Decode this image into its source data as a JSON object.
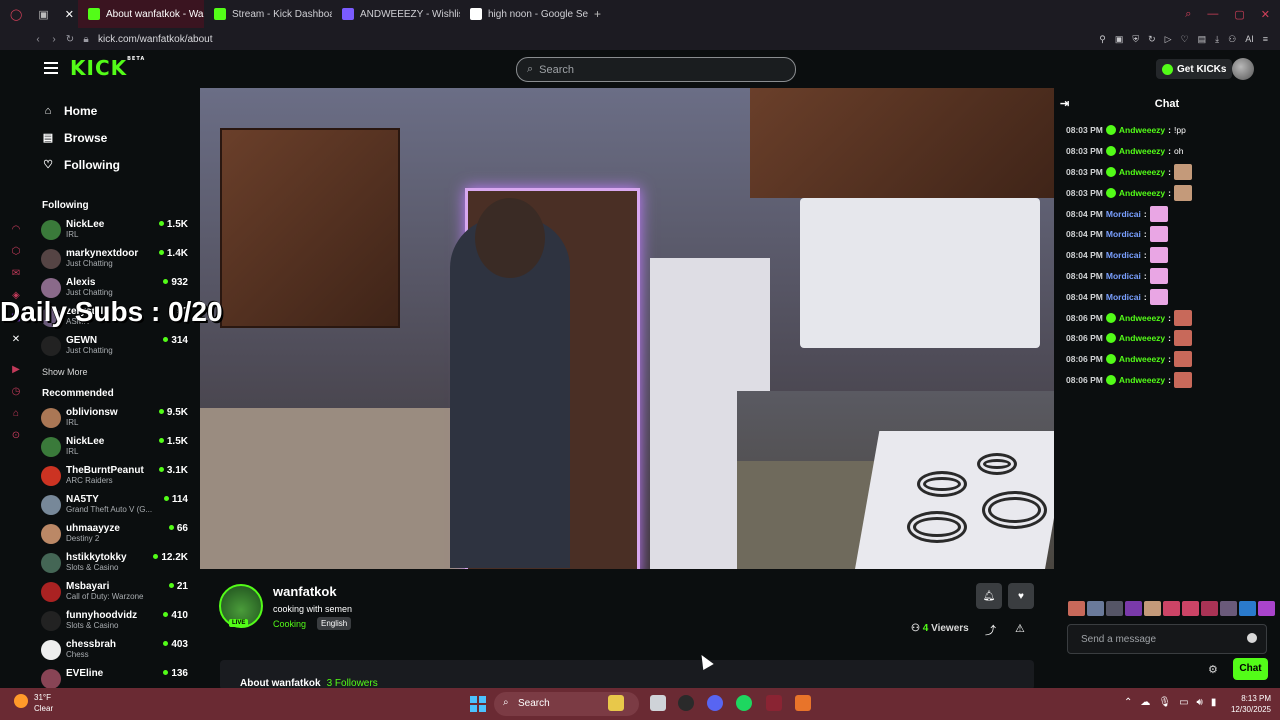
{
  "browser": {
    "tabs": [
      {
        "label": "About wanfatkok - Wa",
        "active": true,
        "favicon_color": "#53fc18"
      },
      {
        "label": "Stream - Kick Dashboard",
        "active": false,
        "favicon_color": "#53fc18"
      },
      {
        "label": "ANDWEEEZY - Wishlist | T",
        "active": false,
        "favicon_color": "#7b5cff"
      },
      {
        "label": "high noon - Google Search",
        "active": false,
        "favicon_color": "#ffffff"
      }
    ],
    "url": "kick.com/wanfatkok/about"
  },
  "header": {
    "logo": "KICK",
    "logo_beta": "BETA",
    "search_placeholder": "Search",
    "get_kicks_label": "Get KICKs"
  },
  "sidebar": {
    "nav": [
      {
        "label": "Home",
        "icon": "home-icon"
      },
      {
        "label": "Browse",
        "icon": "browse-icon"
      },
      {
        "label": "Following",
        "icon": "heart-icon"
      }
    ],
    "following_title": "Following",
    "following": [
      {
        "name": "NickLee",
        "category": "IRL",
        "viewers": "1.5K",
        "color": "#3a7a3a"
      },
      {
        "name": "markynextdoor",
        "category": "Just Chatting",
        "viewers": "1.4K",
        "color": "#554444"
      },
      {
        "name": "Alexis",
        "category": "Just Chatting",
        "viewers": "932",
        "color": "#8a6a8a"
      },
      {
        "name": "zerystal",
        "category": "ASMR",
        "viewers": "50",
        "color": "#6a5a7a"
      },
      {
        "name": "GEWN",
        "category": "Just Chatting",
        "viewers": "314",
        "color": "#222222"
      }
    ],
    "show_more": "Show More",
    "recommended_title": "Recommended",
    "recommended": [
      {
        "name": "oblivionsw",
        "category": "IRL",
        "viewers": "9.5K",
        "color": "#aa7755"
      },
      {
        "name": "NickLee",
        "category": "IRL",
        "viewers": "1.5K",
        "color": "#3a7a3a"
      },
      {
        "name": "TheBurntPeanut",
        "category": "ARC Raiders",
        "viewers": "3.1K",
        "color": "#cc3322"
      },
      {
        "name": "NA5TY",
        "category": "Grand Theft Auto V (G...",
        "viewers": "114",
        "color": "#778899"
      },
      {
        "name": "uhmaayyze",
        "category": "Destiny 2",
        "viewers": "66",
        "color": "#bb8866"
      },
      {
        "name": "hstikkytokky",
        "category": "Slots & Casino",
        "viewers": "12.2K",
        "color": "#446655"
      },
      {
        "name": "Msbayari",
        "category": "Call of Duty: Warzone",
        "viewers": "21",
        "color": "#aa2222"
      },
      {
        "name": "funnyhoodvidz",
        "category": "Slots & Casino",
        "viewers": "410",
        "color": "#222222"
      },
      {
        "name": "chessbrah",
        "category": "Chess",
        "viewers": "403",
        "color": "#eeeeee"
      },
      {
        "name": "EVEline",
        "category": "",
        "viewers": "136",
        "color": "#884455"
      }
    ]
  },
  "overlay": {
    "daily_subs": "Daily Subs : 0/20"
  },
  "stream": {
    "streamer": "wanfatkok",
    "title": "cooking with semen",
    "category": "Cooking",
    "language": "English",
    "live_label": "LIVE",
    "viewers_count": "4",
    "viewers_label": "Viewers",
    "about_title": "About wanfatkok",
    "followers": "3 Followers"
  },
  "chat": {
    "title": "Chat",
    "messages": [
      {
        "time": "08:03 PM",
        "user": "Andweeezy",
        "text": "!pp",
        "emote": ""
      },
      {
        "time": "08:03 PM",
        "user": "Andweeezy",
        "text": "oh",
        "emote": ""
      },
      {
        "time": "08:03 PM",
        "user": "Andweeezy",
        "text": "",
        "emote": "#c49a7a"
      },
      {
        "time": "08:03 PM",
        "user": "Andweeezy",
        "text": "",
        "emote": "#c49a7a"
      },
      {
        "time": "08:04 PM",
        "user": "Mordicai",
        "text": "",
        "emote": "#e9a6e4"
      },
      {
        "time": "08:04 PM",
        "user": "Mordicai",
        "text": "",
        "emote": "#e9a6e4"
      },
      {
        "time": "08:04 PM",
        "user": "Mordicai",
        "text": "",
        "emote": "#e9a6e4"
      },
      {
        "time": "08:04 PM",
        "user": "Mordicai",
        "text": "",
        "emote": "#e9a6e4"
      },
      {
        "time": "08:04 PM",
        "user": "Mordicai",
        "text": "",
        "emote": "#e9a6e4"
      },
      {
        "time": "08:06 PM",
        "user": "Andweeezy",
        "text": "",
        "emote": "#c8695a"
      },
      {
        "time": "08:06 PM",
        "user": "Andweeezy",
        "text": "",
        "emote": "#c8695a"
      },
      {
        "time": "08:06 PM",
        "user": "Andweeezy",
        "text": "",
        "emote": "#c8695a"
      },
      {
        "time": "08:06 PM",
        "user": "Andweeezy",
        "text": "",
        "emote": "#c8695a"
      }
    ],
    "emote_bar": [
      "#c8695a",
      "#6a7a9a",
      "#555566",
      "#7a3aaa",
      "#c49a7a",
      "#cc4466",
      "#cc4466",
      "#aa3355",
      "#6a5a7a",
      "#2a7acc",
      "#aa44cc"
    ],
    "input_placeholder": "Send a message",
    "send_label": "Chat"
  },
  "taskbar": {
    "temperature": "31°F",
    "weather": "Clear",
    "search_label": "Search",
    "time": "8:13 PM",
    "date": "12/30/2025"
  }
}
